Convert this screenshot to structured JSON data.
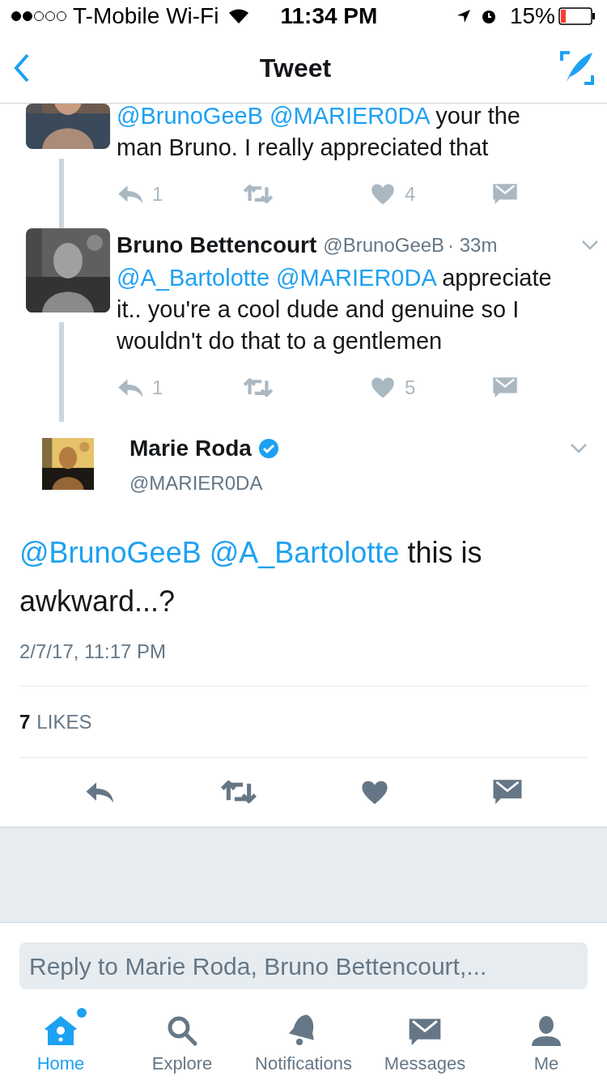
{
  "status_bar": {
    "carrier": "T-Mobile Wi-Fi",
    "time": "11:34 PM",
    "battery": "15%"
  },
  "nav": {
    "title": "Tweet"
  },
  "thread": [
    {
      "kind": "partial",
      "text": [
        {
          "kind": "mention",
          "text": "@BrunoGeeB"
        },
        {
          "kind": "mention",
          "text": "@MARIER0DA"
        },
        {
          "kind": "plain",
          "text": "your the man Bruno. I really appreciated that"
        }
      ],
      "replies": "1",
      "likes": "4"
    },
    {
      "kind": "full",
      "name": "Bruno Bettencourt",
      "handle": "@BrunoGeeB",
      "time": "· 33m",
      "text": [
        {
          "kind": "mention",
          "text": "@A_Bartolotte"
        },
        {
          "kind": "mention",
          "text": "@MARIER0DA"
        },
        {
          "kind": "plain",
          "text": "appreciate it.. you're a cool dude and genuine so I wouldn't do that to a gentlemen"
        }
      ],
      "replies": "1",
      "likes": "5"
    }
  ],
  "main_tweet": {
    "name": "Marie Roda",
    "verified": true,
    "handle": "@MARIER0DA",
    "text": [
      {
        "kind": "mention",
        "text": "@BrunoGeeB"
      },
      {
        "kind": "mention",
        "text": "@A_Bartolotte"
      },
      {
        "kind": "plain",
        "text": "this is awkward...?"
      }
    ],
    "date": "2/7/17, 11:17 PM",
    "like_count": "7",
    "like_label": "LIKES"
  },
  "reply_field": {
    "placeholder": "Reply to Marie Roda, Bruno Bettencourt,..."
  },
  "tabs": [
    {
      "kind": "home",
      "label": "Home",
      "selected": true,
      "dot": true
    },
    {
      "kind": "explore",
      "label": "Explore",
      "selected": false,
      "dot": false
    },
    {
      "kind": "notifications",
      "label": "Notifications",
      "selected": false,
      "dot": false
    },
    {
      "kind": "messages",
      "label": "Messages",
      "selected": false,
      "dot": false
    },
    {
      "kind": "me",
      "label": "Me",
      "selected": false,
      "dot": false
    }
  ]
}
